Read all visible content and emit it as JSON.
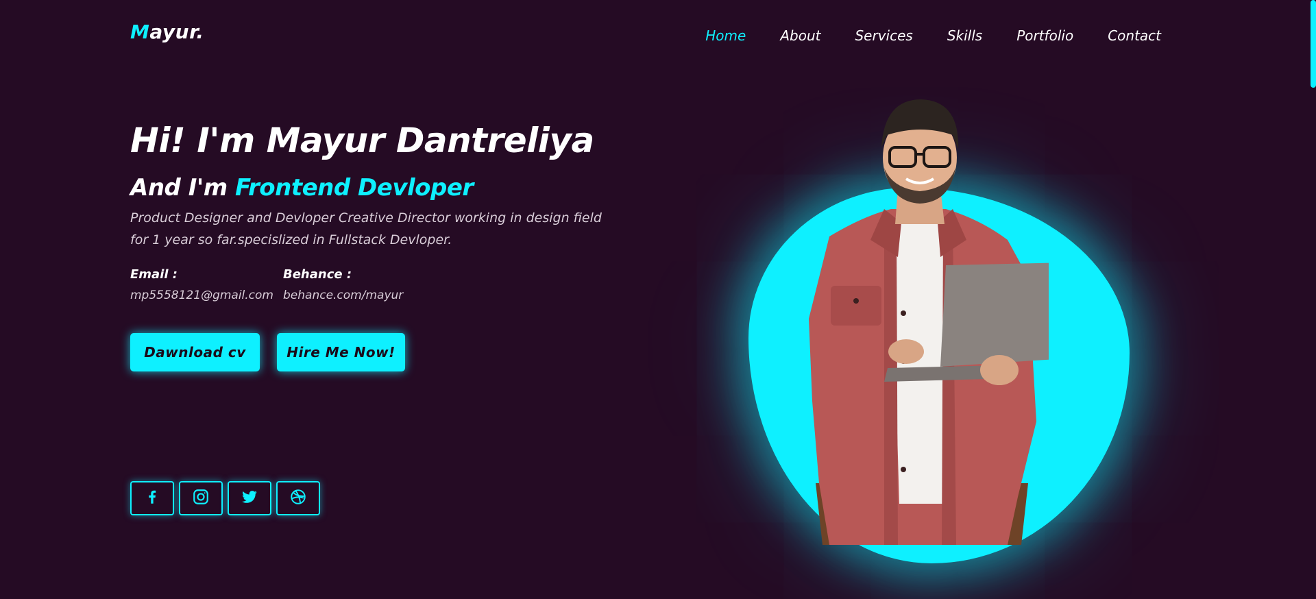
{
  "header": {
    "logo_initial": "M",
    "logo_rest": "ayur.",
    "nav": [
      {
        "label": "Home",
        "active": true
      },
      {
        "label": "About",
        "active": false
      },
      {
        "label": "Services",
        "active": false
      },
      {
        "label": "Skills",
        "active": false
      },
      {
        "label": "Portfolio",
        "active": false
      },
      {
        "label": "Contact",
        "active": false
      }
    ]
  },
  "hero": {
    "title": "Hi! I'm Mayur Dantreliya",
    "subtitle_prefix": "And I'm",
    "subtitle_role": "Frontend Devloper",
    "description": "Product Designer and Devloper Creative Director working in design field for 1 year so far.specislized in Fullstack Devloper.",
    "email_label": "Email :",
    "email_value": "mp5558121@gmail.com",
    "behance_label": "Behance :",
    "behance_value": "behance.com/mayur",
    "download_button": "Dawnload cv",
    "hire_button": "Hire Me Now!"
  },
  "socials": [
    {
      "icon": "facebook-icon"
    },
    {
      "icon": "instagram-icon"
    },
    {
      "icon": "twitter-icon"
    },
    {
      "icon": "dribbble-icon"
    }
  ],
  "colors": {
    "background": "#250b24",
    "accent": "#0ef0ff",
    "text": "#ffffff",
    "muted_text": "#d9cdd8"
  }
}
